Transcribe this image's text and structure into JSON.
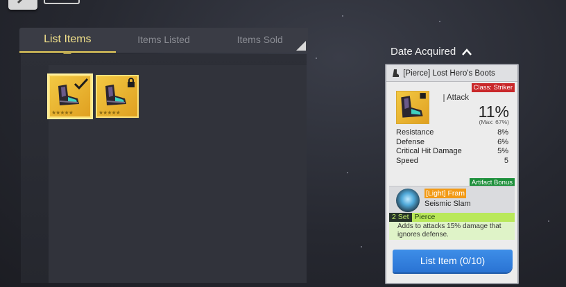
{
  "tabs": [
    {
      "label": "List Items",
      "active": true
    },
    {
      "label": "Items Listed",
      "active": false
    },
    {
      "label": "Items Sold",
      "active": false
    }
  ],
  "sort": {
    "label": "Date Acquired",
    "direction": "up"
  },
  "inventory": [
    {
      "name": "Lost Hero's Boots",
      "selected": true,
      "locked": false,
      "stars": 5
    },
    {
      "name": "Lost Hero's Boots",
      "selected": false,
      "locked": true,
      "stars": 5
    }
  ],
  "item": {
    "title": "[Pierce] Lost Hero's Boots",
    "class_badge": "Class: Striker",
    "main_stat": {
      "label": "Attack",
      "value": "11%",
      "max": "(Max: 67%)"
    },
    "substats": [
      {
        "label": "Resistance",
        "value": "8%"
      },
      {
        "label": "Defense",
        "value": "6%"
      },
      {
        "label": "Critical Hit Damage",
        "value": "5%"
      },
      {
        "label": "Speed",
        "value": "5"
      }
    ],
    "artifact_badge": "Artifact Bonus",
    "artifact_name": "[Light] Fram",
    "artifact_skill": "Seismic Slam",
    "set_count": "2 Set",
    "set_name": "Pierce",
    "set_desc": "Adds to attacks 15% damage that ignores defense."
  },
  "list_button": "List Item (0/10)",
  "colors": {
    "accent_yellow": "#e9cf5c",
    "class_red": "#c9282a",
    "artifact_green": "#1d8f3b",
    "set_green": "#b9e85a",
    "button_blue": "#2a73d3"
  }
}
